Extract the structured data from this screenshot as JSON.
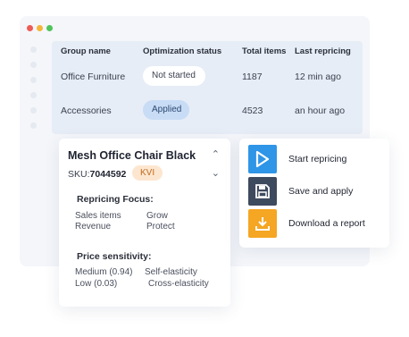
{
  "window": {
    "colors": {
      "red": "#ee5b55",
      "yellow": "#f3b63a",
      "green": "#4fc35a"
    }
  },
  "table": {
    "headers": [
      "Group name",
      "Optimization status",
      "Total items",
      "Last repricing"
    ],
    "rows": [
      {
        "group": "Office Furniture",
        "status": "Not started",
        "total": "1187",
        "last": "12 min ago"
      },
      {
        "group": "Accessories",
        "status": "Applied",
        "total": "4523",
        "last": "an hour ago"
      }
    ]
  },
  "product": {
    "name": "Mesh Office Chair Black",
    "sku_label": "SKU:",
    "sku": "7044592",
    "badge": "KVI",
    "focus_title": "Repricing Focus:",
    "focus": [
      {
        "key": "Sales items",
        "value": "Grow"
      },
      {
        "key": "Revenue",
        "value": "Protect"
      }
    ],
    "sensitivity_title": "Price sensitivity:",
    "sensitivity": [
      {
        "key": "Medium (0.94)",
        "value": "Self-elasticity"
      },
      {
        "key": "Low (0.03)",
        "value": "Cross-elasticity"
      }
    ]
  },
  "actions": [
    {
      "label": "Start repricing",
      "icon": "play-icon",
      "color": "#2f95e7"
    },
    {
      "label": "Save and apply",
      "icon": "floppy-disk-icon",
      "color": "#3e4a5e"
    },
    {
      "label": "Download a report",
      "icon": "download-icon",
      "color": "#f5a623"
    }
  ]
}
